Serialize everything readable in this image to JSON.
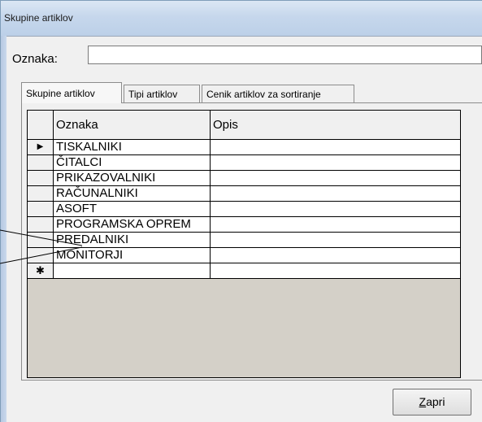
{
  "window": {
    "title": "Skupine artiklov"
  },
  "form": {
    "oznaka_label": "Oznaka:",
    "oznaka_value": ""
  },
  "tabs": [
    {
      "label": "Skupine artiklov",
      "active": true
    },
    {
      "label": "Tipi artiklov",
      "active": false
    },
    {
      "label": "Cenik artiklov za sortiranje",
      "active": false
    }
  ],
  "grid": {
    "columns": [
      "Oznaka",
      "Opis"
    ],
    "current_row_marker": "▶",
    "new_row_marker": "✱",
    "rows": [
      {
        "oznaka": "TISKALNIKI",
        "opis": ""
      },
      {
        "oznaka": "ČITALCI",
        "opis": ""
      },
      {
        "oznaka": "PRIKAZOVALNIKI",
        "opis": ""
      },
      {
        "oznaka": "RAČUNALNIKI",
        "opis": ""
      },
      {
        "oznaka": "ASOFT",
        "opis": ""
      },
      {
        "oznaka": "PROGRAMSKA OPREM",
        "opis": ""
      },
      {
        "oznaka": "PREDALNIKI",
        "opis": ""
      },
      {
        "oznaka": "MONITORJI",
        "opis": ""
      }
    ]
  },
  "buttons": {
    "close_prefix": "Z",
    "close_rest": "apri"
  }
}
